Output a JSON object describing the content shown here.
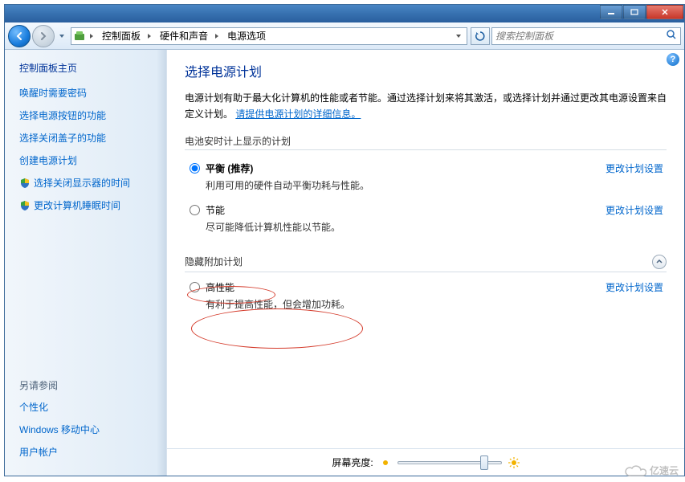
{
  "titlebar": {},
  "address": {
    "segments": [
      "控制面板",
      "硬件和声音",
      "电源选项"
    ]
  },
  "search": {
    "placeholder": "搜索控制面板"
  },
  "sidebar": {
    "home": "控制面板主页",
    "links": [
      "唤醒时需要密码",
      "选择电源按钮的功能",
      "选择关闭盖子的功能",
      "创建电源计划",
      "选择关闭显示器的时间",
      "更改计算机睡眠时间"
    ],
    "see_also_title": "另请参阅",
    "see_also": [
      "个性化",
      "Windows 移动中心",
      "用户帐户"
    ]
  },
  "main": {
    "heading": "选择电源计划",
    "desc_pre": "电源计划有助于最大化计算机的性能或者节能。通过选择计划来将其激活，或选择计划并通过更改其电源设置来自定义计划。",
    "desc_link": "请提供电源计划的详细信息。",
    "section_battery": "电池安时计上显示的计划",
    "plans": [
      {
        "name": "平衡 (推荐)",
        "desc": "利用可用的硬件自动平衡功耗与性能。",
        "link": "更改计划设置",
        "bold": true
      },
      {
        "name": "节能",
        "desc": "尽可能降低计算机性能以节能。",
        "link": "更改计划设置",
        "bold": false
      }
    ],
    "hidden_plans_label": "隐藏附加计划",
    "hidden_plan": {
      "name": "高性能",
      "desc": "有利于提高性能，但会增加功耗。",
      "link": "更改计划设置"
    },
    "brightness_label": "屏幕亮度:"
  },
  "watermark": "亿速云"
}
